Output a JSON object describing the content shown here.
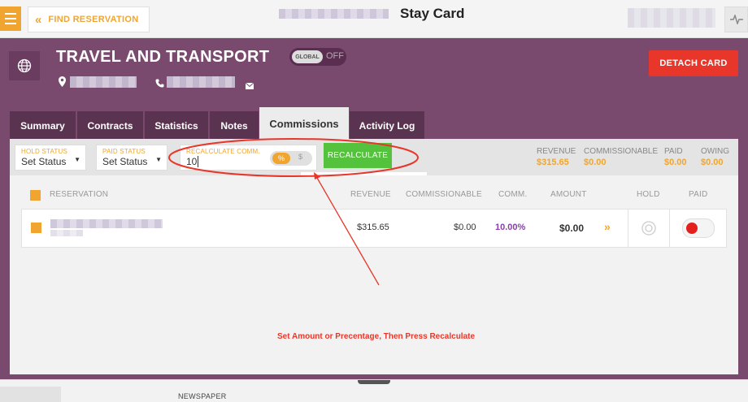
{
  "topbar": {
    "find_reservation": "FIND RESERVATION",
    "title": "Stay Card"
  },
  "header": {
    "company_name": "TRAVEL AND TRANSPORT",
    "global_label": "GLOBAL",
    "global_state": "OFF",
    "detach_label": "DETACH CARD"
  },
  "tabs": [
    {
      "label": "Summary"
    },
    {
      "label": "Contracts"
    },
    {
      "label": "Statistics"
    },
    {
      "label": "Notes"
    },
    {
      "label": "Commissions",
      "active": true
    },
    {
      "label": "Activity Log"
    }
  ],
  "filters": {
    "hold_status": {
      "caption": "HOLD STATUS",
      "value": "Set Status"
    },
    "paid_status": {
      "caption": "PAID STATUS",
      "value": "Set Status"
    },
    "recalc": {
      "caption": "RECALCULATE COMM.",
      "value": "10",
      "percent": "%",
      "dollar": "$"
    },
    "recalc_button": "RECALCULATE"
  },
  "summary": {
    "revenue": {
      "label": "REVENUE",
      "value": "$315.65"
    },
    "commissionable": {
      "label": "COMMISSIONABLE",
      "value": "$0.00"
    },
    "paid": {
      "label": "PAID",
      "value": "$0.00"
    },
    "owing": {
      "label": "OWING",
      "value": "$0.00"
    }
  },
  "table": {
    "headers": {
      "reservation": "RESERVATION",
      "revenue": "REVENUE",
      "commissionable": "COMMISSIONABLE",
      "comm": "COMM.",
      "amount": "AMOUNT",
      "hold": "HOLD",
      "paid": "PAID"
    },
    "rows": [
      {
        "revenue": "$315.65",
        "commissionable": "$0.00",
        "comm": "10.00%",
        "amount": "$0.00",
        "paid": false
      }
    ]
  },
  "annotation": "Set Amount or Precentage, Then Press Recalculate",
  "bottom": {
    "newspaper": "NEWSPAPER"
  },
  "colors": {
    "accent": "#f0a530",
    "header_bg": "#7a4a6e",
    "detach": "#e8372a",
    "recalc": "#55c23e",
    "comm_value": "#8a3fa8"
  }
}
